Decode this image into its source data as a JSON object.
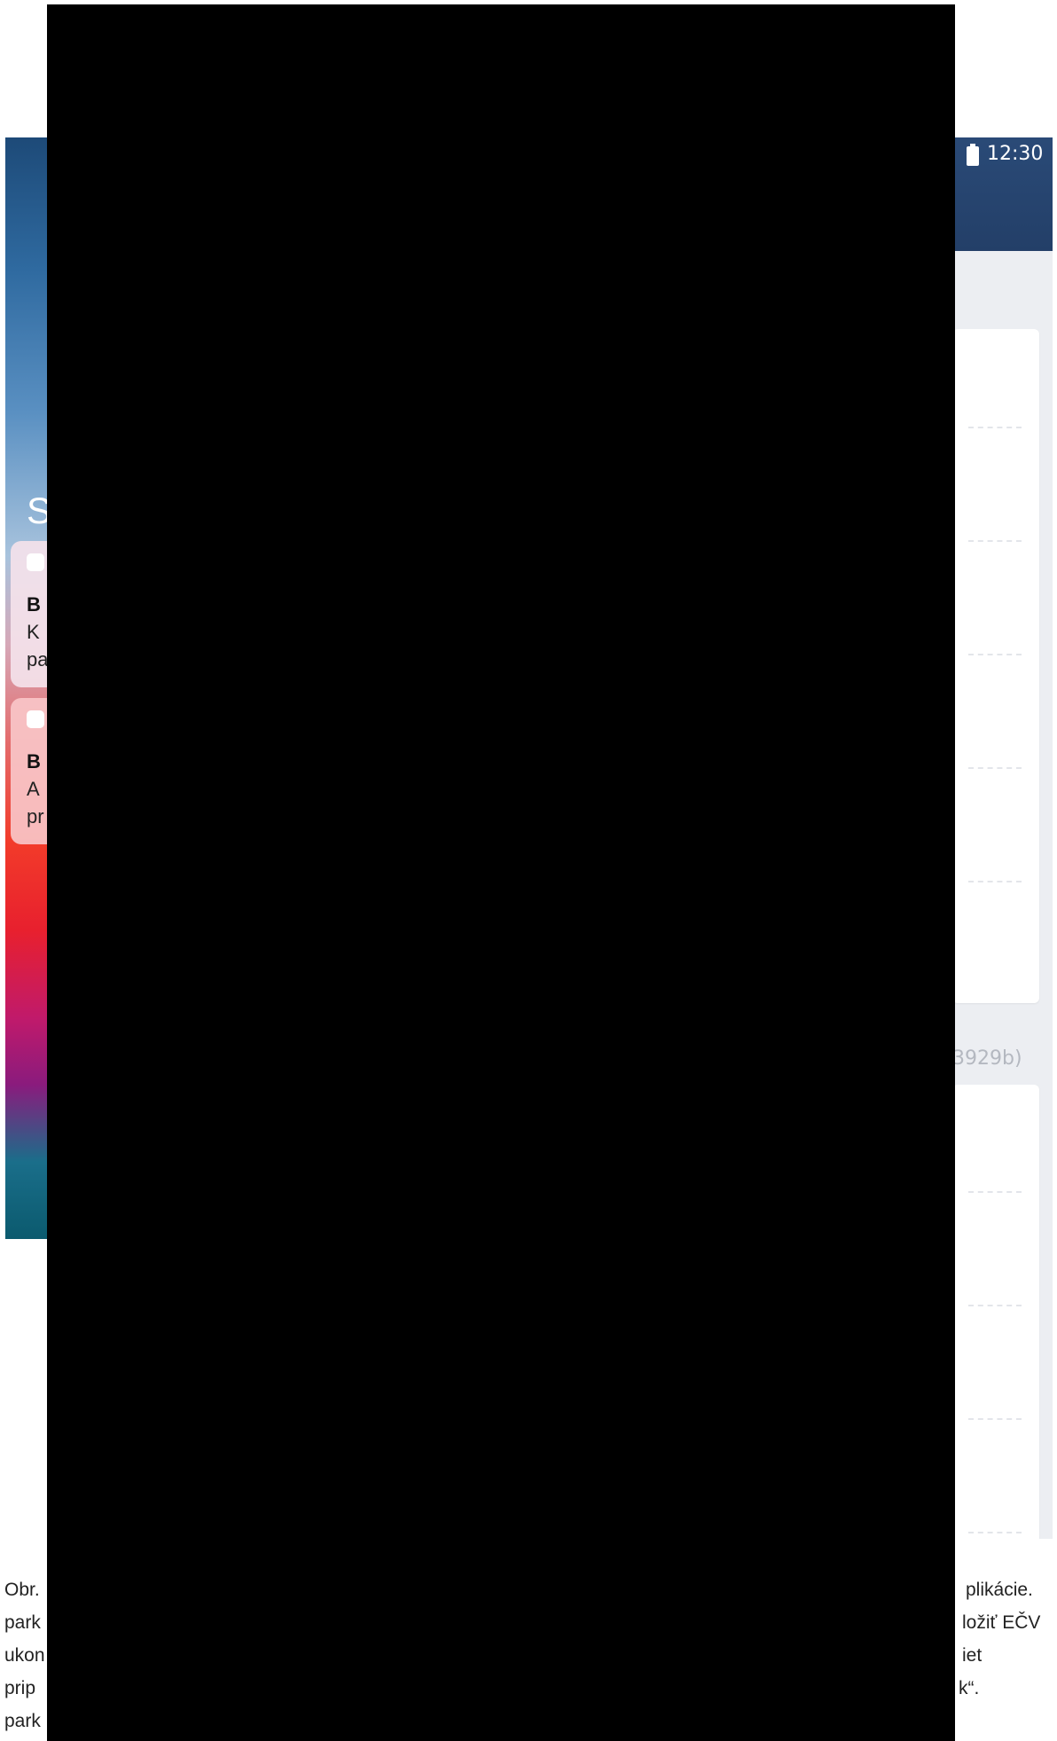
{
  "left_screen": {
    "heading_fragment": "S",
    "notifications": [
      {
        "lines": [
          "B",
          "K",
          "pa"
        ]
      },
      {
        "lines": [
          "B",
          "A",
          "pr"
        ]
      }
    ]
  },
  "right_screen": {
    "status_time": "12:30",
    "section_caption_fragment": "3929b)",
    "colors": {
      "header": "#2a4a77",
      "background": "#eceef2",
      "card": "#ffffff"
    }
  },
  "caption": {
    "left_fragments": [
      "Obr.",
      "park",
      "ukon",
      "prip",
      "park"
    ],
    "right_fragments": [
      "plikácie.",
      "ložiť EČV",
      "iet",
      "k“."
    ]
  }
}
